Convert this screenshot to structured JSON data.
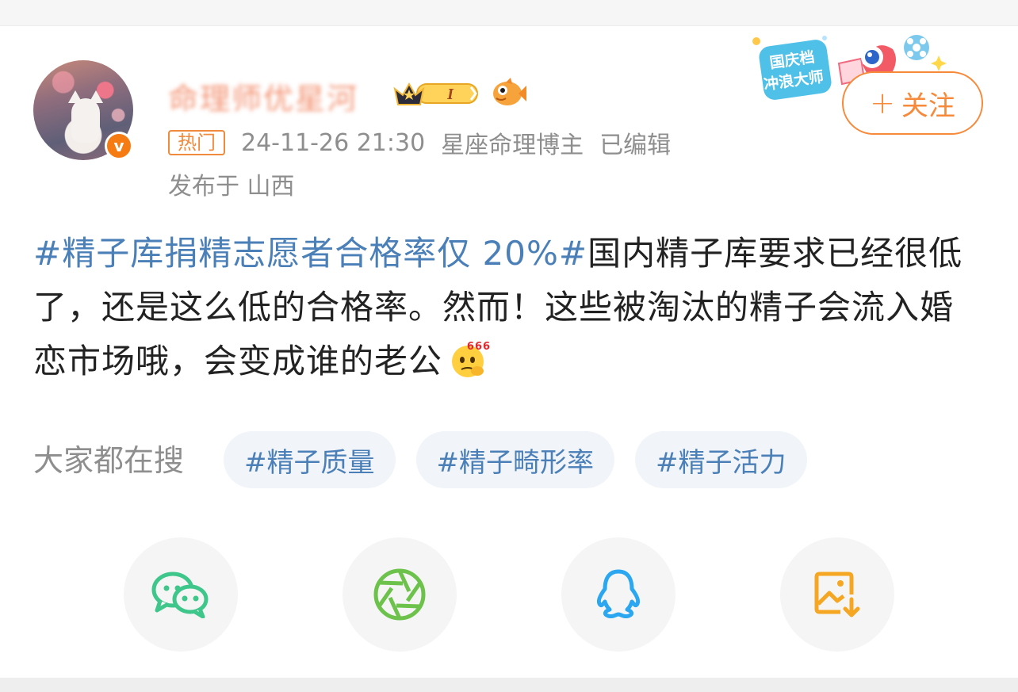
{
  "header": {
    "username": "命理师优星河",
    "verified_mark": "v",
    "level_badge": "I"
  },
  "meta": {
    "hot_tag": "热门",
    "timestamp": "24-11-26 21:30",
    "role": "星座命理博主",
    "edited": "已编辑",
    "location": "发布于 山西"
  },
  "sticker": {
    "line1": "国庆档",
    "line2": "冲浪大师"
  },
  "follow": {
    "plus": "+",
    "label": "关注"
  },
  "post": {
    "hashtag": "#精子库捐精志愿者合格率仅 20%#",
    "body": "国内精子库要求已经很低了，还是这么低的合格率。然而！这些被淘汰的精子会流入婚恋市场哦，会变成谁的老公",
    "emoji_text": "666"
  },
  "search": {
    "label": "大家都在搜",
    "chips": [
      "#精子质量",
      "#精子畸形率",
      "#精子活力"
    ]
  },
  "share": [
    {
      "icon": "wechat-icon",
      "color": "#3ec68b"
    },
    {
      "icon": "moments-icon",
      "color": "#6cc24a"
    },
    {
      "icon": "qq-icon",
      "color": "#2aa7f0"
    },
    {
      "icon": "save-image-icon",
      "color": "#f5a623"
    }
  ],
  "colors": {
    "accent_orange": "#f7893a",
    "link_blue": "#4a7fb8",
    "muted_gray": "#8e8e8e"
  }
}
